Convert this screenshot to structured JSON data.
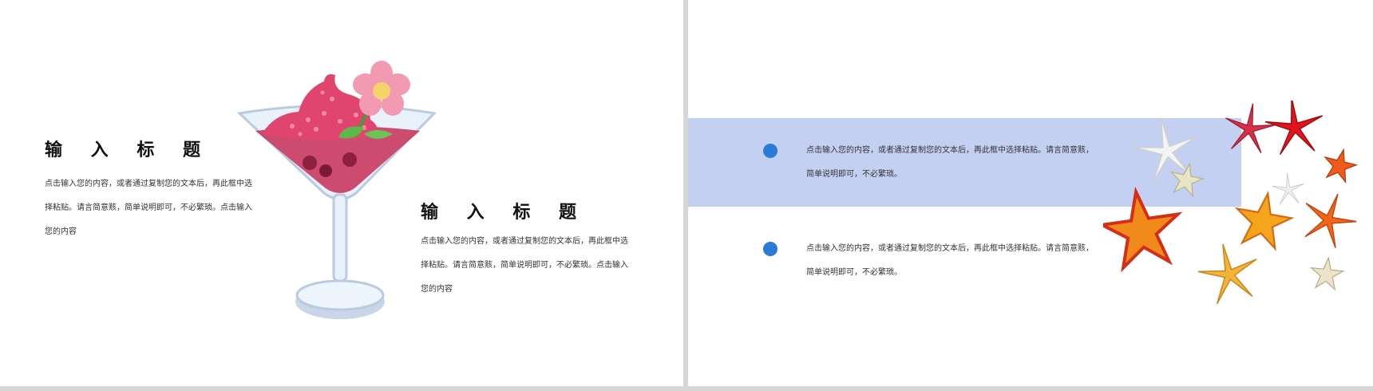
{
  "left_slide": {
    "block1": {
      "title": "输 入 标 题",
      "body": "点击输入您的内容，或者通过复制您的文本后，再此框中选择粘贴。请言简意赅，简单说明即可，不必繁琐。点击输入您的内容"
    },
    "block2": {
      "title": "输 入 标 题",
      "body": "点击输入您的内容，或者通过复制您的文本后，再此框中选择粘贴。请言简意赅，简单说明即可，不必繁琐。点击输入您的内容"
    },
    "illustration": "cocktail-glass-with-flower"
  },
  "right_slide": {
    "band_color": "#c4d0f2",
    "bullet_color": "#2a7bd6",
    "bullets": [
      {
        "text": "点击输入您的内容，或者通过复制您的文本后，再此框中选择粘贴。请言简意赅，简单说明即可，不必繁琐。"
      },
      {
        "text": "点击输入您的内容，或者通过复制您的文本后，再此框中选择粘贴。请言简意赅，简单说明即可，不必繁琐。"
      }
    ],
    "illustration": "starfish-cluster"
  }
}
